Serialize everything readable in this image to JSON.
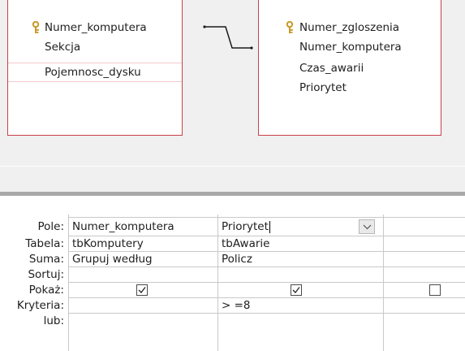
{
  "left_table": {
    "fields": [
      {
        "name": "Numer_komputera",
        "is_key": true
      },
      {
        "name": "Sekcja",
        "is_key": false
      },
      {
        "name": "Pojemnosc_dysku",
        "is_key": false
      }
    ]
  },
  "right_table": {
    "fields": [
      {
        "name": "Numer_zgloszenia",
        "is_key": true
      },
      {
        "name": "Numer_komputera",
        "is_key": false
      },
      {
        "name": "Czas_awarii",
        "is_key": false
      },
      {
        "name": "Priorytet",
        "is_key": false
      }
    ]
  },
  "grid": {
    "row_labels": {
      "pole": "Pole:",
      "tabela": "Tabela:",
      "suma": "Suma:",
      "sortuj": "Sortuj:",
      "pokaz": "Pokaż:",
      "kryteria": "Kryteria:",
      "lub": "lub:"
    },
    "columns": [
      {
        "pole": "Numer_komputera",
        "tabela": "tbKomputery",
        "suma": "Grupuj według",
        "sortuj": "",
        "pokaz": true,
        "kryteria": "",
        "lub": ""
      },
      {
        "pole": "Priorytet",
        "tabela": "tbAwarie",
        "suma": "Policz",
        "sortuj": "",
        "pokaz": true,
        "kryteria": "> =8",
        "lub": "",
        "active": true
      },
      {
        "pole": "",
        "tabela": "",
        "suma": "",
        "sortuj": "",
        "pokaz": false,
        "kryteria": "",
        "lub": ""
      }
    ]
  },
  "icons": {
    "key": "key-icon",
    "dropdown": "chevron-down-icon",
    "check": "checkmark-icon"
  },
  "colors": {
    "table_border": "#c8414a",
    "field_separator": "#f3c8cc",
    "key_icon": "#c89a2a",
    "splitter": "#a8a8a8"
  }
}
